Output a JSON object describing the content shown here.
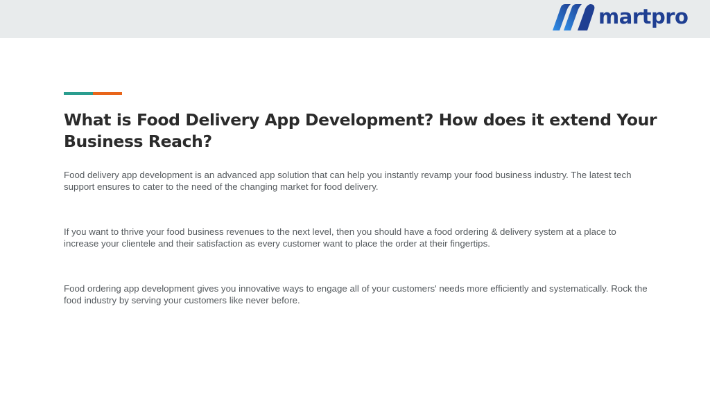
{
  "brand": {
    "name": "martpro",
    "logo_icon": "martpro-m-logo-icon",
    "colors": {
      "logo_dark": "#1f3f92",
      "logo_light": "#2f8fe8",
      "header_bg": "#e8ebec",
      "accent_teal": "#2a9d8f",
      "accent_orange": "#e8651a",
      "title": "#2b2b2b",
      "body_text": "#555a5e"
    }
  },
  "content": {
    "title": "What is Food Delivery App Development? How does it extend Your Business Reach?",
    "paragraphs": [
      "Food delivery app development is an advanced app solution that can help you instantly revamp your food business industry. The latest tech support ensures to cater to the need of the changing market for food delivery.",
      "If you want to thrive your food business revenues to the next level, then you should have a food ordering & delivery system at a place to increase your clientele and their satisfaction as every customer want to place the order at their fingertips.",
      "Food ordering app development gives you innovative ways to engage all of your customers' needs more efficiently and systematically. Rock the food industry by serving your customers like never before."
    ]
  }
}
